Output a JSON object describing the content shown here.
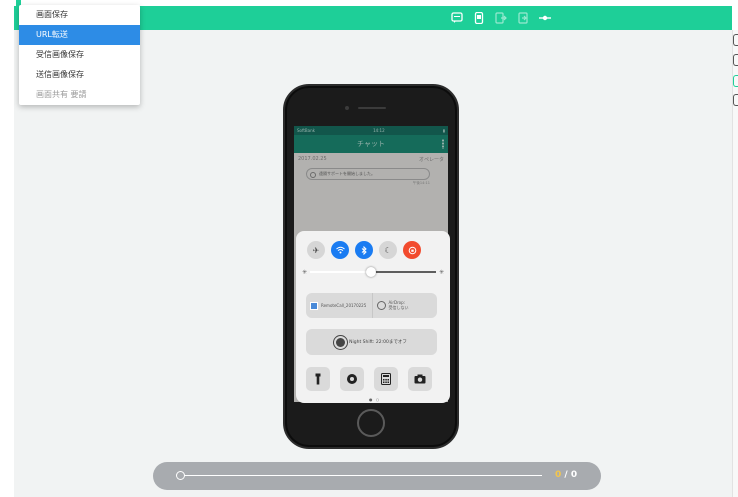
{
  "menu": {
    "items": [
      {
        "label": "画面保存",
        "state": "normal"
      },
      {
        "label": "URL転送",
        "state": "active"
      },
      {
        "label": "受信画像保存",
        "state": "normal"
      },
      {
        "label": "送信画像保存",
        "state": "normal"
      },
      {
        "label": "画面共有 要請",
        "state": "disabled"
      }
    ]
  },
  "toolbar": {
    "icons": [
      "chat-icon",
      "phone-device-icon",
      "export-icon",
      "import-icon",
      "link-icon"
    ]
  },
  "phone_screen": {
    "status_carrier": "SoftBank",
    "status_time": "14:12",
    "title": "チャット",
    "date": "2017.02.25",
    "operator": "オペレータ",
    "message": "遠隔サポートを開始しました。",
    "message_time": "午後14:11"
  },
  "control_center": {
    "screenshot_label": "RemoteCall_20170225",
    "airdrop_label": "AirDrop:",
    "airdrop_state": "受信しない",
    "night_shift": "Night Shift: 22:00までオフ",
    "toggles": [
      "airplane-icon",
      "wifi-icon",
      "bluetooth-icon",
      "moon-icon",
      "rotation-lock-icon"
    ],
    "shortcuts": [
      "flashlight-icon",
      "timer-icon",
      "calculator-icon",
      "camera-icon"
    ],
    "brightness": 0.5
  },
  "playback": {
    "current": "0",
    "separator": " / ",
    "total": "0",
    "progress": 0
  },
  "colors": {
    "topbar": "#1ecf98",
    "menu_active": "#2d8ce6",
    "playbar": "#a8abaf",
    "counter_current": "#f4c64a"
  }
}
